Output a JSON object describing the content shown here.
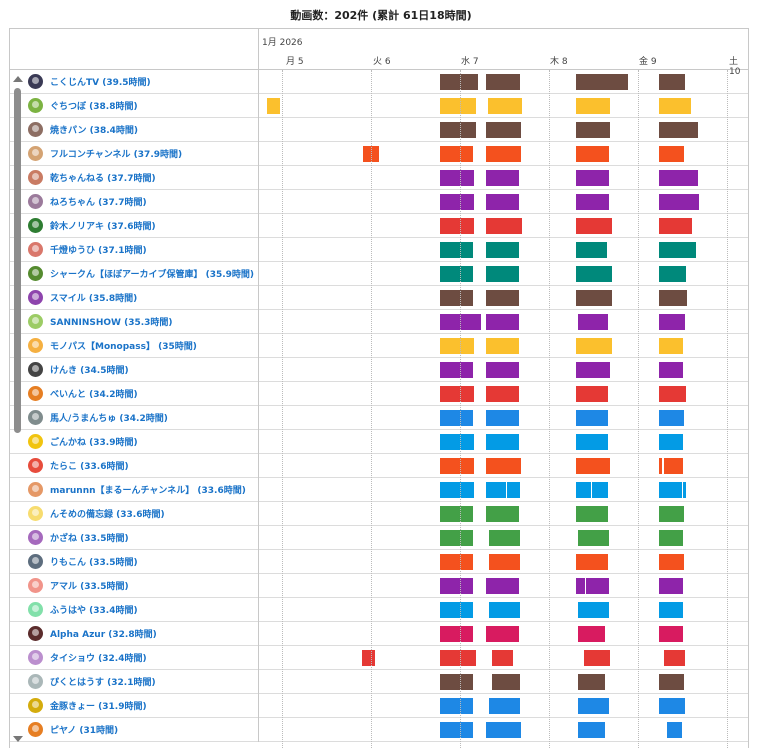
{
  "header": {
    "title": "動画数：202件 (累計 61日18時間)"
  },
  "timeline": {
    "month_label": "1月 2026",
    "days": [
      {
        "label": "月 5"
      },
      {
        "label": "火 6"
      },
      {
        "label": "水 7"
      },
      {
        "label": "木 8"
      },
      {
        "label": "金 9"
      },
      {
        "label": "土 10"
      }
    ]
  },
  "colors": {
    "brown": "#6d4c41",
    "yellow": "#fbc02d",
    "orange": "#f4511e",
    "purple": "#8e24aa",
    "red": "#e53935",
    "teal": "#00897b",
    "blue": "#1e88e5",
    "lightblue": "#039be5",
    "green": "#43a047",
    "pink": "#d81b60"
  },
  "rows": [
    {
      "name": "こくじんTV (39.5時間)",
      "avatar_color": "#3a3a55",
      "color": "brown",
      "bars": [
        [
          0.05,
          0.47
        ],
        [
          0.56,
          0.94
        ],
        [
          1.57,
          2.16
        ],
        [
          2.5,
          2.8
        ]
      ]
    },
    {
      "name": "ぐちつぼ (38.8時間)",
      "avatar_color": "#7cb342",
      "color": "yellow",
      "bars": [
        [
          -1.9,
          -1.75
        ],
        [
          0.05,
          0.45
        ],
        [
          0.58,
          0.97
        ],
        [
          1.57,
          1.96
        ],
        [
          2.5,
          2.86
        ]
      ]
    },
    {
      "name": "焼きパン (38.4時間)",
      "avatar_color": "#8d6e63",
      "color": "brown",
      "bars": [
        [
          0.05,
          0.45
        ],
        [
          0.56,
          0.96
        ],
        [
          1.57,
          1.96
        ],
        [
          2.5,
          2.94
        ]
      ]
    },
    {
      "name": "フルコンチャンネル (37.9時間)",
      "avatar_color": "#d4a373",
      "color": "orange",
      "bars": [
        [
          -0.82,
          -0.64
        ],
        [
          0.05,
          0.42
        ],
        [
          0.56,
          0.95
        ],
        [
          1.57,
          1.94
        ],
        [
          2.5,
          2.79
        ]
      ]
    },
    {
      "name": "乾ちゃんねる (37.7時間)",
      "avatar_color": "#c97b63",
      "color": "purple",
      "bars": [
        [
          0.05,
          0.43
        ],
        [
          0.56,
          0.93
        ],
        [
          1.57,
          1.94
        ],
        [
          2.5,
          2.94
        ]
      ]
    },
    {
      "name": "ねろちゃん (37.7時間)",
      "avatar_color": "#9b7a9b",
      "color": "purple",
      "bars": [
        [
          0.05,
          0.43
        ],
        [
          0.56,
          0.93
        ],
        [
          1.57,
          1.94
        ],
        [
          2.5,
          2.96
        ]
      ]
    },
    {
      "name": "鈴木ノリアキ (37.6時間)",
      "avatar_color": "#2e7d32",
      "color": "red",
      "bars": [
        [
          0.05,
          0.43
        ],
        [
          0.56,
          0.97
        ],
        [
          1.57,
          1.98
        ],
        [
          2.5,
          2.88
        ]
      ]
    },
    {
      "name": "千燈ゆうひ (37.1時間)",
      "avatar_color": "#d9776b",
      "color": "teal",
      "bars": [
        [
          0.05,
          0.42
        ],
        [
          0.56,
          0.93
        ],
        [
          1.57,
          1.92
        ],
        [
          2.5,
          2.92
        ]
      ]
    },
    {
      "name": "シャークん【ほぼアーカイブ保管庫】 (35.9時間)",
      "avatar_color": "#558b2f",
      "color": "teal",
      "bars": [
        [
          0.05,
          0.42
        ],
        [
          0.56,
          0.93
        ],
        [
          1.57,
          1.98
        ],
        [
          2.5,
          2.81
        ]
      ]
    },
    {
      "name": "スマイル (35.8時間)",
      "avatar_color": "#8e44ad",
      "color": "brown",
      "bars": [
        [
          0.05,
          0.42
        ],
        [
          0.56,
          0.93
        ],
        [
          1.57,
          1.98
        ],
        [
          2.5,
          2.82
        ]
      ]
    },
    {
      "name": "SANNINSHOW (35.3時間)",
      "avatar_color": "#9ccc65",
      "color": "purple",
      "bars": [
        [
          0.05,
          0.51
        ],
        [
          0.56,
          0.93
        ],
        [
          1.6,
          1.93
        ],
        [
          2.5,
          2.8
        ]
      ]
    },
    {
      "name": "モノパス【Monopass】 (35時間)",
      "avatar_color": "#f5b041",
      "color": "yellow",
      "bars": [
        [
          0.05,
          0.43
        ],
        [
          0.56,
          0.93
        ],
        [
          1.57,
          1.98
        ],
        [
          2.5,
          2.78
        ]
      ]
    },
    {
      "name": "けんき (34.5時間)",
      "avatar_color": "#444444",
      "color": "purple",
      "bars": [
        [
          0.05,
          0.42
        ],
        [
          0.56,
          0.93
        ],
        [
          1.57,
          1.95
        ],
        [
          2.5,
          2.78
        ]
      ]
    },
    {
      "name": "べいんと (34.2時間)",
      "avatar_color": "#e67e22",
      "color": "red",
      "bars": [
        [
          0.05,
          0.43
        ],
        [
          0.56,
          0.93
        ],
        [
          1.57,
          1.93
        ],
        [
          2.5,
          2.81
        ]
      ]
    },
    {
      "name": "馬人/うまんちゅ (34.2時間)",
      "avatar_color": "#7f8c8d",
      "color": "blue",
      "bars": [
        [
          0.05,
          0.42
        ],
        [
          0.56,
          0.93
        ],
        [
          1.57,
          1.93
        ],
        [
          2.5,
          2.79
        ]
      ]
    },
    {
      "name": "ごんかね (33.9時間)",
      "avatar_color": "#f1c40f",
      "color": "lightblue",
      "bars": [
        [
          0.05,
          0.43
        ],
        [
          0.56,
          0.93
        ],
        [
          1.57,
          1.93
        ],
        [
          2.5,
          2.78
        ]
      ]
    },
    {
      "name": "たらこ (33.6時間)",
      "avatar_color": "#e74c3c",
      "color": "orange",
      "bars": [
        [
          0.05,
          0.43
        ],
        [
          0.56,
          0.95
        ],
        [
          1.57,
          1.96
        ],
        [
          2.5,
          2.54
        ],
        [
          2.56,
          2.78
        ]
      ]
    },
    {
      "name": "marunnn【まるーんチャンネル】 (33.6時間)",
      "avatar_color": "#e59866",
      "color": "lightblue",
      "bars": [
        [
          0.05,
          0.43
        ],
        [
          0.56,
          0.79
        ],
        [
          0.8,
          0.94
        ],
        [
          1.57,
          1.74
        ],
        [
          1.75,
          1.93
        ],
        [
          2.5,
          2.76
        ],
        [
          2.77,
          2.8
        ]
      ]
    },
    {
      "name": "んそめの備忘録 (33.6時間)",
      "avatar_color": "#f7dc6f",
      "color": "green",
      "bars": [
        [
          0.05,
          0.42
        ],
        [
          0.56,
          0.93
        ],
        [
          1.57,
          1.93
        ],
        [
          2.5,
          2.79
        ]
      ]
    },
    {
      "name": "かざね (33.5時間)",
      "avatar_color": "#a569bd",
      "color": "green",
      "bars": [
        [
          0.05,
          0.42
        ],
        [
          0.59,
          0.94
        ],
        [
          1.6,
          1.94
        ],
        [
          2.5,
          2.78
        ]
      ]
    },
    {
      "name": "りもこん (33.5時間)",
      "avatar_color": "#5d6d7e",
      "color": "orange",
      "bars": [
        [
          0.05,
          0.42
        ],
        [
          0.59,
          0.94
        ],
        [
          1.57,
          1.93
        ],
        [
          2.5,
          2.79
        ]
      ]
    },
    {
      "name": "アマル (33.5時間)",
      "avatar_color": "#f1948a",
      "color": "purple",
      "bars": [
        [
          0.05,
          0.42
        ],
        [
          0.56,
          0.93
        ],
        [
          1.57,
          1.67
        ],
        [
          1.68,
          1.94
        ],
        [
          2.5,
          2.78
        ]
      ]
    },
    {
      "name": "ふうはや (33.4時間)",
      "avatar_color": "#82e0aa",
      "color": "lightblue",
      "bars": [
        [
          0.05,
          0.42
        ],
        [
          0.59,
          0.94
        ],
        [
          1.6,
          1.94
        ],
        [
          2.5,
          2.78
        ]
      ]
    },
    {
      "name": "Alpha Azur (32.8時間)",
      "avatar_color": "#5b2c2c",
      "color": "pink",
      "bars": [
        [
          0.05,
          0.42
        ],
        [
          0.56,
          0.93
        ],
        [
          1.59,
          1.9
        ],
        [
          2.5,
          2.77
        ]
      ]
    },
    {
      "name": "タイショウ (32.4時間)",
      "avatar_color": "#bb8fce",
      "color": "red",
      "bars": [
        [
          -0.83,
          -0.68
        ],
        [
          0.05,
          0.45
        ],
        [
          0.63,
          0.86
        ],
        [
          1.66,
          1.95
        ],
        [
          2.56,
          2.8
        ]
      ]
    },
    {
      "name": "ぴくとはうす (32.1時間)",
      "avatar_color": "#aab7b8",
      "color": "brown",
      "bars": [
        [
          0.05,
          0.42
        ],
        [
          0.63,
          0.94
        ],
        [
          1.6,
          1.9
        ],
        [
          2.5,
          2.79
        ]
      ]
    },
    {
      "name": "金豚きょー (31.9時間)",
      "avatar_color": "#d4ac0d",
      "color": "blue",
      "bars": [
        [
          0.05,
          0.42
        ],
        [
          0.6,
          0.94
        ],
        [
          1.6,
          1.94
        ],
        [
          2.5,
          2.8
        ]
      ]
    },
    {
      "name": "ピヤノ (31時間)",
      "avatar_color": "#e67e22",
      "color": "blue",
      "bars": [
        [
          0.05,
          0.42
        ],
        [
          0.56,
          0.95
        ],
        [
          1.6,
          1.9
        ],
        [
          2.6,
          2.76
        ]
      ]
    }
  ]
}
